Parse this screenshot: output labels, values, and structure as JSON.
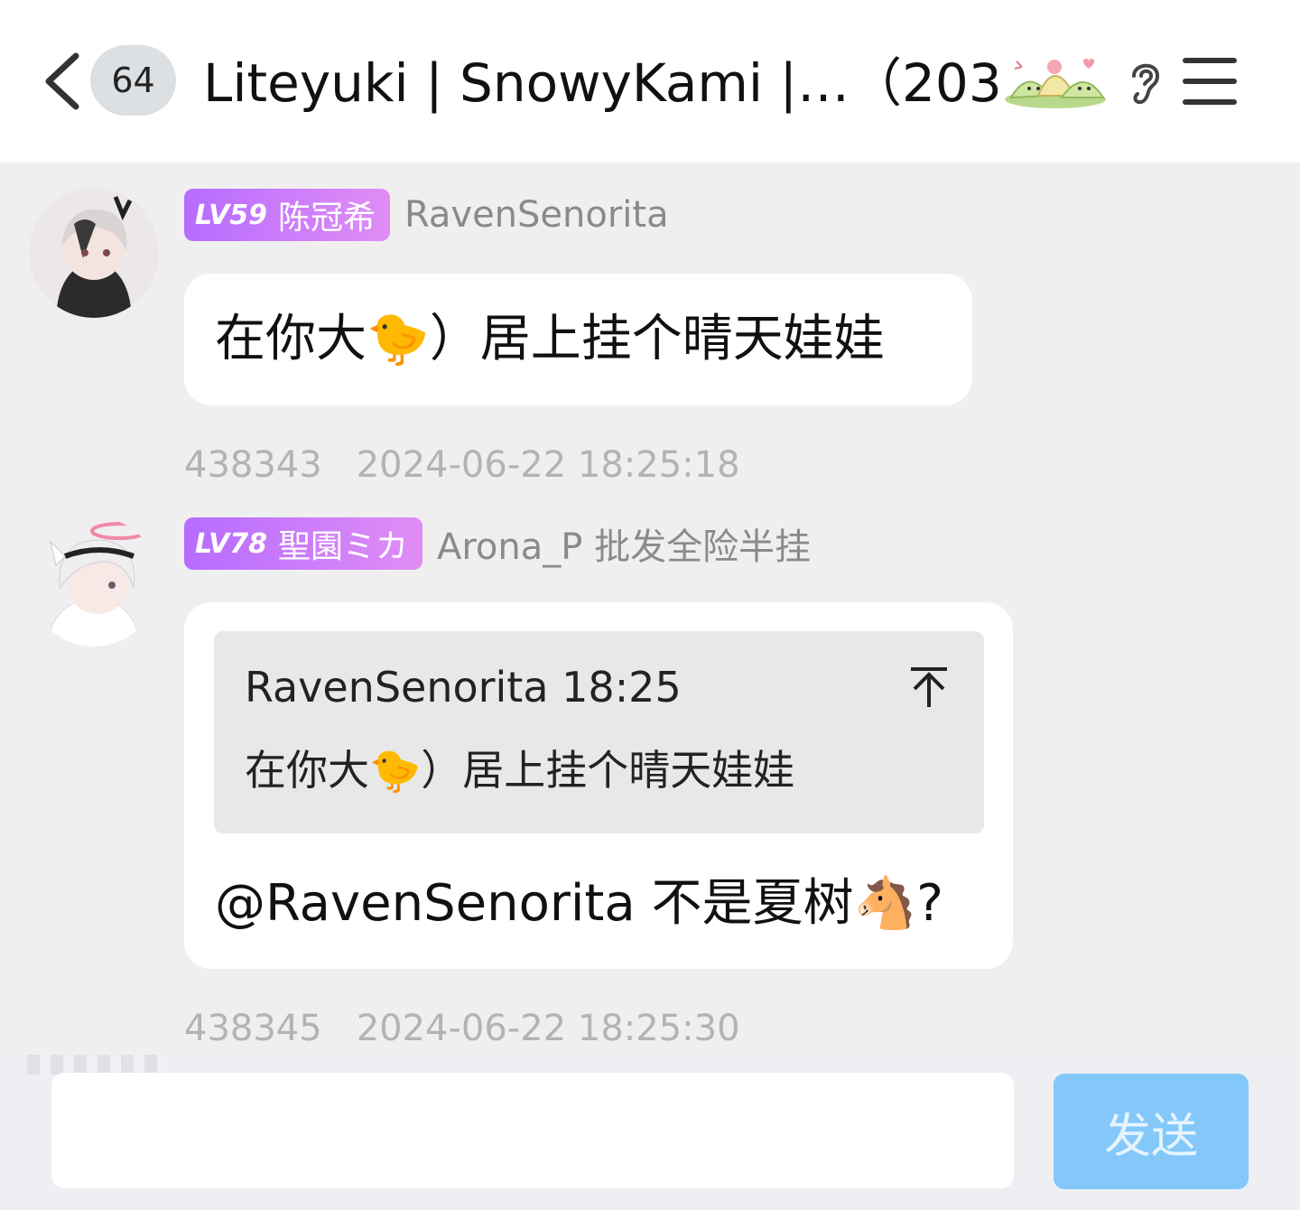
{
  "header": {
    "unread_count": "64",
    "title": "Liteyuki | SnowyKami |…（203）",
    "sticker_icon": "zongzi-sticker-icon",
    "ear_icon": "ear-icon",
    "menu_icon": "menu-icon"
  },
  "messages": [
    {
      "level": "LV59",
      "nickname": "陈冠希",
      "sender": "RavenSenorita",
      "text": "在你大🐤）居上挂个晴天娃娃",
      "msg_id": "438343",
      "time": "2024-06-22 18:25:18"
    },
    {
      "level": "LV78",
      "nickname": "聖園ミカ",
      "sender": "Arona_P 批发全险半挂",
      "quote": {
        "header": "RavenSenorita 18:25",
        "text": "在你大🐤）居上挂个晴天娃娃"
      },
      "text": "@RavenSenorita 不是夏树🐴?",
      "msg_id": "438345",
      "time": "2024-06-22 18:25:30"
    }
  ],
  "composer": {
    "placeholder": "",
    "send_label": "发送"
  },
  "colors": {
    "level_badge_start": "#b66cff",
    "level_badge_end": "#e08df5",
    "send_button": "#84c8fa",
    "background": "#efefef"
  }
}
